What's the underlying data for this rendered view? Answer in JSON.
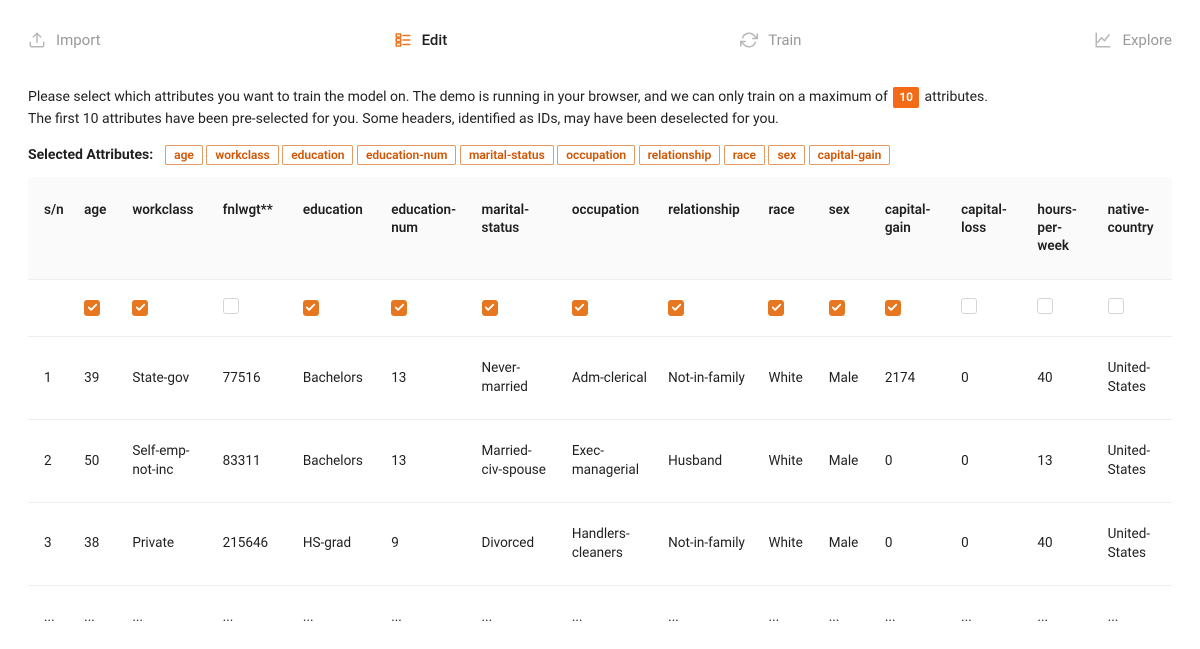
{
  "tabs": {
    "import": "Import",
    "edit": "Edit",
    "train": "Train",
    "explore": "Explore",
    "active": "edit"
  },
  "instruction": {
    "line1_pre": "Please select which attributes you want to train the model on. The demo is running in your browser, and we can only train on a maximum of ",
    "max_badge": "10",
    "line1_post": " attributes.",
    "line2": "The first 10 attributes have been pre-selected for you. Some headers, identified as IDs, may have been deselected for you."
  },
  "selected_label": "Selected Attributes:",
  "selected_attrs": [
    "age",
    "workclass",
    "education",
    "education-num",
    "marital-status",
    "occupation",
    "relationship",
    "race",
    "sex",
    "capital-gain"
  ],
  "columns": [
    {
      "key": "sn",
      "label": "s/n",
      "selectable": false,
      "checked": false
    },
    {
      "key": "age",
      "label": "age",
      "selectable": true,
      "checked": true
    },
    {
      "key": "workclass",
      "label": "workclass",
      "selectable": true,
      "checked": true
    },
    {
      "key": "fnlwgt",
      "label": "fnlwgt**",
      "selectable": true,
      "checked": false
    },
    {
      "key": "education",
      "label": "education",
      "selectable": true,
      "checked": true
    },
    {
      "key": "education-num",
      "label": "education-num",
      "selectable": true,
      "checked": true
    },
    {
      "key": "marital-status",
      "label": "marital-status",
      "selectable": true,
      "checked": true
    },
    {
      "key": "occupation",
      "label": "occupation",
      "selectable": true,
      "checked": true
    },
    {
      "key": "relationship",
      "label": "relationship",
      "selectable": true,
      "checked": true
    },
    {
      "key": "race",
      "label": "race",
      "selectable": true,
      "checked": true
    },
    {
      "key": "sex",
      "label": "sex",
      "selectable": true,
      "checked": true
    },
    {
      "key": "capital-gain",
      "label": "capital-gain",
      "selectable": true,
      "checked": true
    },
    {
      "key": "capital-loss",
      "label": "capital-loss",
      "selectable": true,
      "checked": false
    },
    {
      "key": "hours-per-week",
      "label": "hours-per-week",
      "selectable": true,
      "checked": false
    },
    {
      "key": "native-country",
      "label": "native-country",
      "selectable": true,
      "checked": false
    }
  ],
  "rows": [
    {
      "sn": "1",
      "age": "39",
      "workclass": "State-gov",
      "fnlwgt": "77516",
      "education": "Bachelors",
      "education-num": "13",
      "marital-status": "Never-married",
      "occupation": "Adm-clerical",
      "relationship": "Not-in-family",
      "race": "White",
      "sex": "Male",
      "capital-gain": "2174",
      "capital-loss": "0",
      "hours-per-week": "40",
      "native-country": "United-States"
    },
    {
      "sn": "2",
      "age": "50",
      "workclass": "Self-emp-not-inc",
      "fnlwgt": "83311",
      "education": "Bachelors",
      "education-num": "13",
      "marital-status": "Married-civ-spouse",
      "occupation": "Exec-managerial",
      "relationship": "Husband",
      "race": "White",
      "sex": "Male",
      "capital-gain": "0",
      "capital-loss": "0",
      "hours-per-week": "13",
      "native-country": "United-States"
    },
    {
      "sn": "3",
      "age": "38",
      "workclass": "Private",
      "fnlwgt": "215646",
      "education": "HS-grad",
      "education-num": "9",
      "marital-status": "Divorced",
      "occupation": "Handlers-cleaners",
      "relationship": "Not-in-family",
      "race": "White",
      "sex": "Male",
      "capital-gain": "0",
      "capital-loss": "0",
      "hours-per-week": "40",
      "native-country": "United-States"
    },
    {
      "sn": "...",
      "age": "...",
      "workclass": "...",
      "fnlwgt": "...",
      "education": "...",
      "education-num": "...",
      "marital-status": "...",
      "occupation": "...",
      "relationship": "...",
      "race": "...",
      "sex": "...",
      "capital-gain": "...",
      "capital-loss": "...",
      "hours-per-week": "...",
      "native-country": "..."
    }
  ]
}
